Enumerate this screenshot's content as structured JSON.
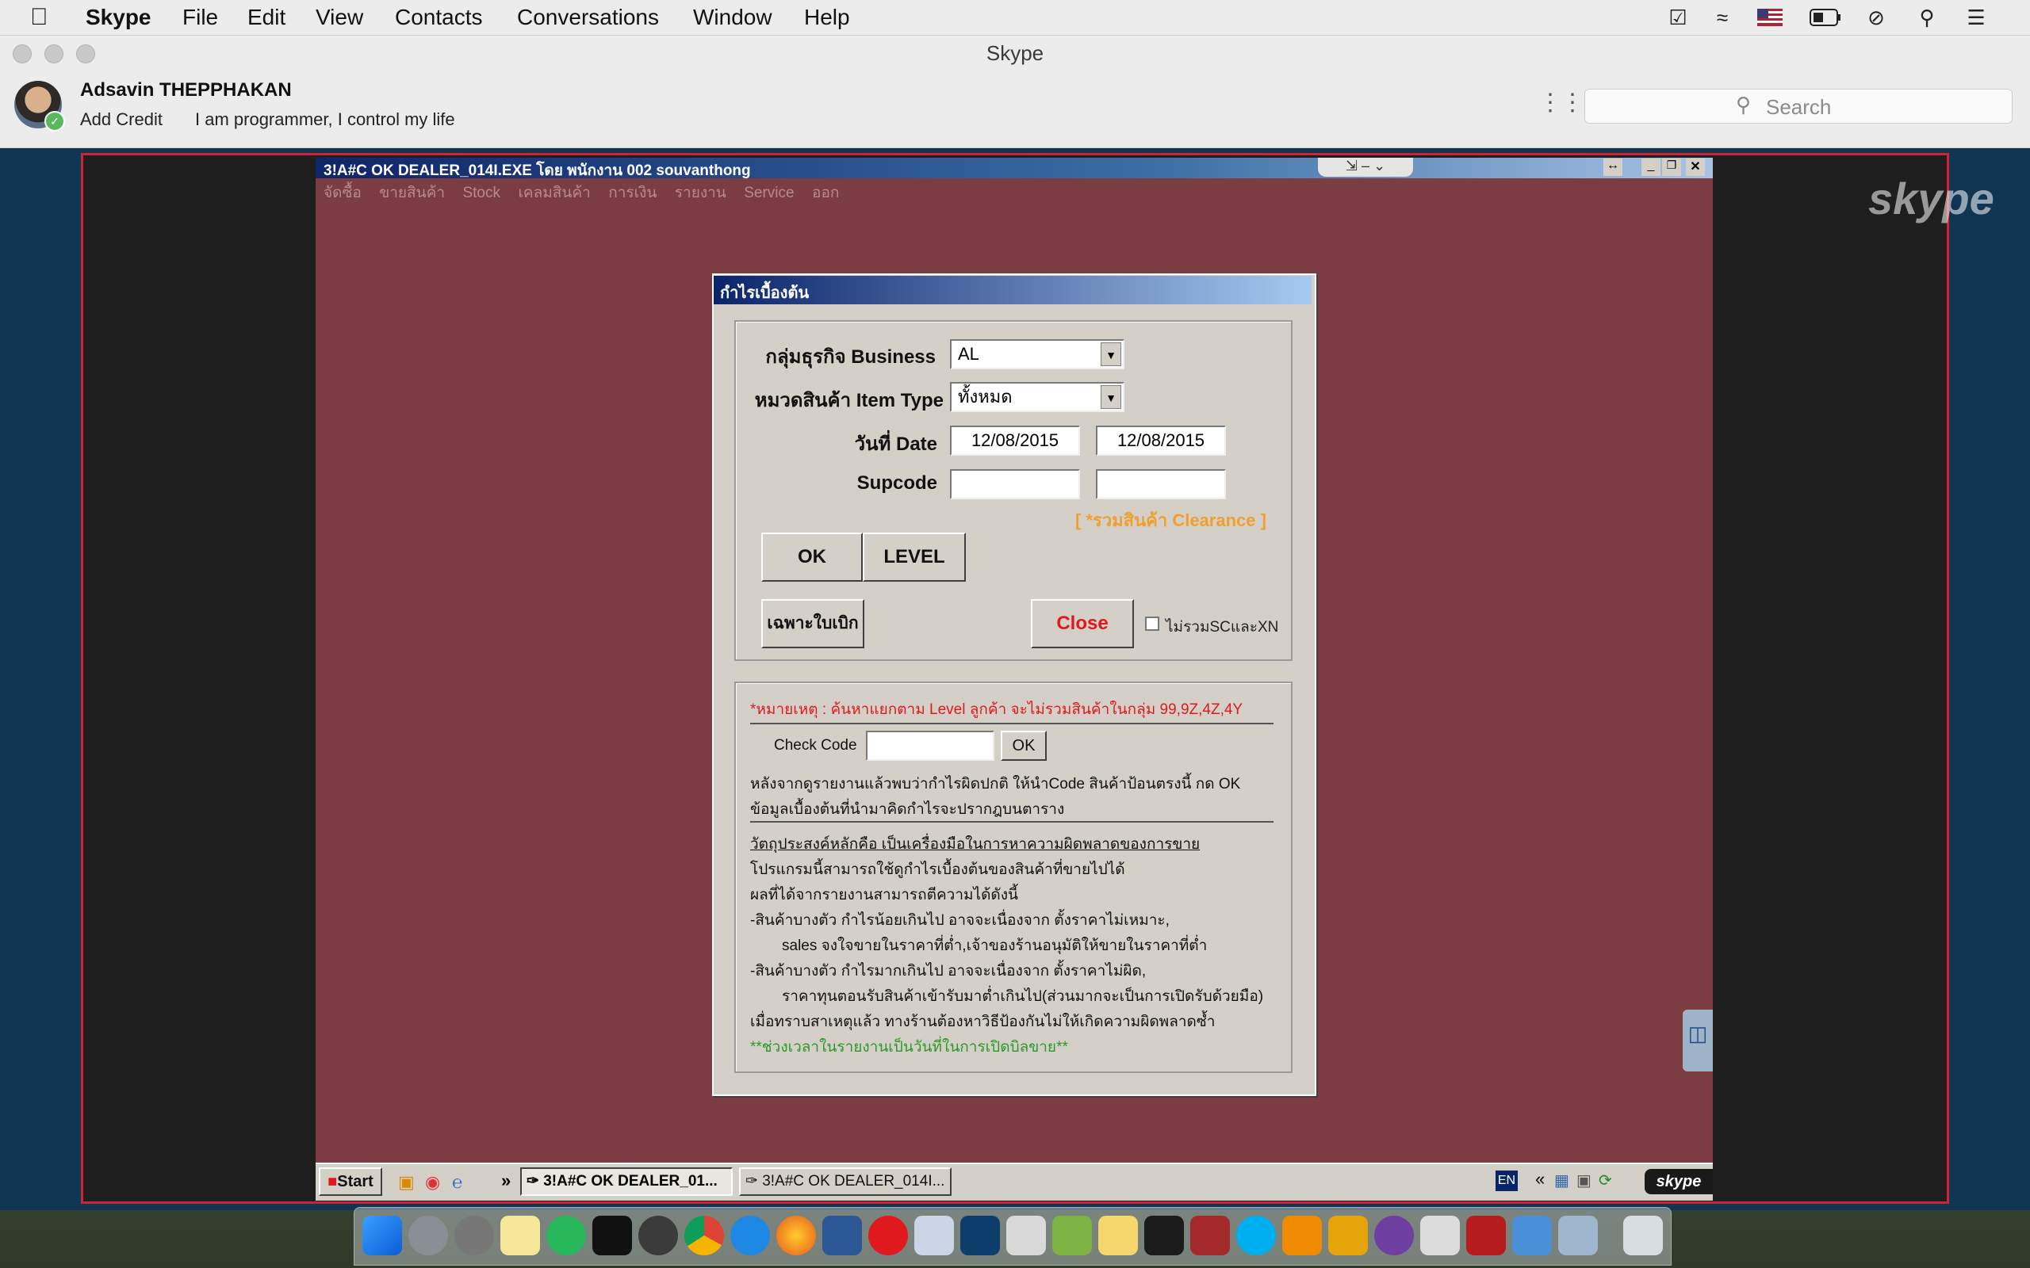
{
  "menubar": {
    "apple": "",
    "app": "Skype",
    "items": [
      "File",
      "Edit",
      "View",
      "Contacts",
      "Conversations",
      "Window",
      "Help"
    ]
  },
  "window": {
    "title": "Skype"
  },
  "profile": {
    "name": "Adsavin THEPPHAKAN",
    "add_credit": "Add Credit",
    "mood": "I am programmer, I control my life",
    "search_placeholder": "Search"
  },
  "call": {
    "watermark": "skype"
  },
  "remote": {
    "title": "3!A#C OK DEALER_014I.EXE โดย พนักงาน 002 souvanthong",
    "menu": [
      "จัดซื้อ",
      "ขายสินค้า",
      "Stock",
      "เคลมสินค้า",
      "การเงิน",
      "รายงาน",
      "Service",
      "ออก"
    ],
    "dialog": {
      "title": "กำไรเบื้องต้น",
      "business_label": "กลุ่มธุรกิจ Business",
      "business_value": "AL",
      "itemtype_label": "หมวดสินค้า Item Type",
      "itemtype_value": "ทั้งหมด",
      "date_label": "วันที่ Date",
      "date_from": "12/08/2015",
      "date_to": "12/08/2015",
      "supcode_label": "Supcode",
      "supcode_from": "",
      "supcode_to": "",
      "clearance": "[ *รวมสินค้า Clearance ]",
      "ok": "OK",
      "level": "LEVEL",
      "open_only": "เฉพาะใบเบิก",
      "close": "Close",
      "exclude_label": "ไม่รวมSCและXN",
      "remark": "*หมายเหตุ : ค้นหาแยกตาม Level ลูกค้า จะไม่รวมสินค้าในกลุ่ม 99,9Z,4Z,4Y",
      "check_code_label": "Check Code",
      "check_code_value": "",
      "check_ok": "OK",
      "info1": "หลังจากดูรายงานแล้วพบว่ากำไรผิดปกติ ให้นำCode สินค้าป้อนตรงนี้ กด OK",
      "info2": "ข้อมูลเบื้องต้นที่นำมาคิดกำไรจะปรากฎบนตาราง",
      "purpose_title": "วัตถุประสงค์หลักคือ เป็นเครื่องมือในการหาความผิดพลาดของการขาย",
      "lines": [
        "โปรแกรมนี้สามารถใช้ดูกำไรเบื้องต้นของสินค้าที่ขายไปได้",
        "ผลที่ได้จากรายงานสามารถตีความได้ดังนี้",
        "-สินค้าบางตัว กำไรน้อยเกินไป อาจจะเนื่องจาก ตั้งราคาไม่เหมาะ,",
        "sales จงใจขายในราคาที่ต่ำ,เจ้าของร้านอนุมัติให้ขายในราคาที่ต่ำ",
        "-สินค้าบางตัว กำไรมากเกินไป อาจจะเนื่องจาก ตั้งราคาไม่ผิด,",
        "ราคาทุนตอนรับสินค้าเข้ารับมาต่ำเกินไป(ส่วนมากจะเป็นการเปิดรับด้วยมือ)",
        "เมื่อทราบสาเหตุแล้ว ทางร้านต้องหาวิธีป้องกันไม่ให้เกิดความผิดพลาดซ้ำ"
      ],
      "green_note": "**ช่วงเวลาในรายงานเป็นวันที่ในการเปิดบิลขาย**"
    },
    "taskbar": {
      "start": "Start",
      "task1": "3!A#C OK DEALER_01...",
      "task2": "3!A#C OK DEALER_014I...",
      "lang": "EN",
      "chev": "«"
    }
  },
  "colors": {
    "accent_red": "#d0232f",
    "remote_bg": "#7c3d42",
    "dialog_bg": "#d4d0c8"
  }
}
